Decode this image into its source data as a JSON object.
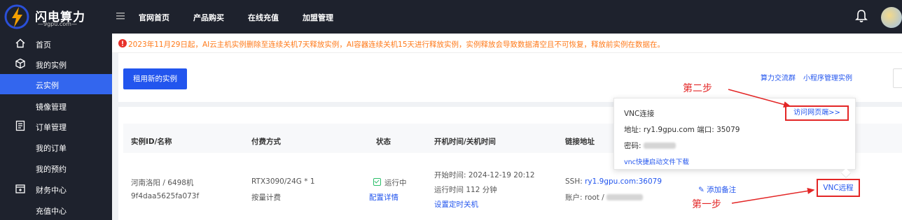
{
  "brand": {
    "title": "闪电算力",
    "subtitle": "—9gpu.com—"
  },
  "topnav": [
    "官网首页",
    "产品购买",
    "在线充值",
    "加盟管理"
  ],
  "sidebar": [
    {
      "label": "首页",
      "type": "top",
      "icon": "home-icon"
    },
    {
      "label": "我的实例",
      "type": "top",
      "icon": "cube-icon"
    },
    {
      "label": "云实例",
      "type": "sub",
      "active": true
    },
    {
      "label": "镜像管理",
      "type": "sub"
    },
    {
      "label": "订单管理",
      "type": "top",
      "icon": "document-icon"
    },
    {
      "label": "我的订单",
      "type": "sub"
    },
    {
      "label": "我的预约",
      "type": "sub"
    },
    {
      "label": "财务中心",
      "type": "top",
      "icon": "wallet-icon"
    },
    {
      "label": "充值中心",
      "type": "sub"
    }
  ],
  "notice": "2023年11月29日起，AI云主机实例删除至连续关机7天释放实例，AI容器连续关机15天进行释放实例，实例释放会导致数据清空且不可恢复，释放前实例在数据在。",
  "toolbar": {
    "rent_button": "租用新的实例",
    "links": [
      "算力交流群",
      "小程序管理实例"
    ]
  },
  "table": {
    "headers": [
      "实例ID/名称",
      "付费方式",
      "状态",
      "开机时间/关机时间",
      "链接地址"
    ],
    "row": {
      "location": "河南洛阳 / 6498机",
      "instance_id": "9f4daa5625fa073f",
      "gpu": "RTX3090/24G * 1",
      "billing": "按量计费",
      "status": "运行中",
      "config_link": "配置详情",
      "start_time": "开始时间:  2024-12-19 20:12",
      "run_time": "运行时间 112 分钟",
      "timer_link": "设置定时关机",
      "ssh_label": "SSH: ",
      "ssh_value": "ry1.9gpu.com:36079",
      "account": "账户: root / ",
      "add_note": "添加备注",
      "vnc_button": "VNC远程"
    }
  },
  "popup": {
    "title": "VNC连接",
    "address": "地址: ry1.9gpu.com 端口: 35079",
    "password_label": "密码: ",
    "download_link": "vnc快捷启动文件下载",
    "visit_link": "访问网页端>>"
  },
  "annotations": {
    "step1": "第一步",
    "step2": "第二步"
  },
  "colors": {
    "accent": "#2255ee",
    "sidebar_bg": "#1e222d",
    "notice": "#ff7a1a",
    "annotation": "#e32626",
    "running": "#2bbf6a"
  }
}
